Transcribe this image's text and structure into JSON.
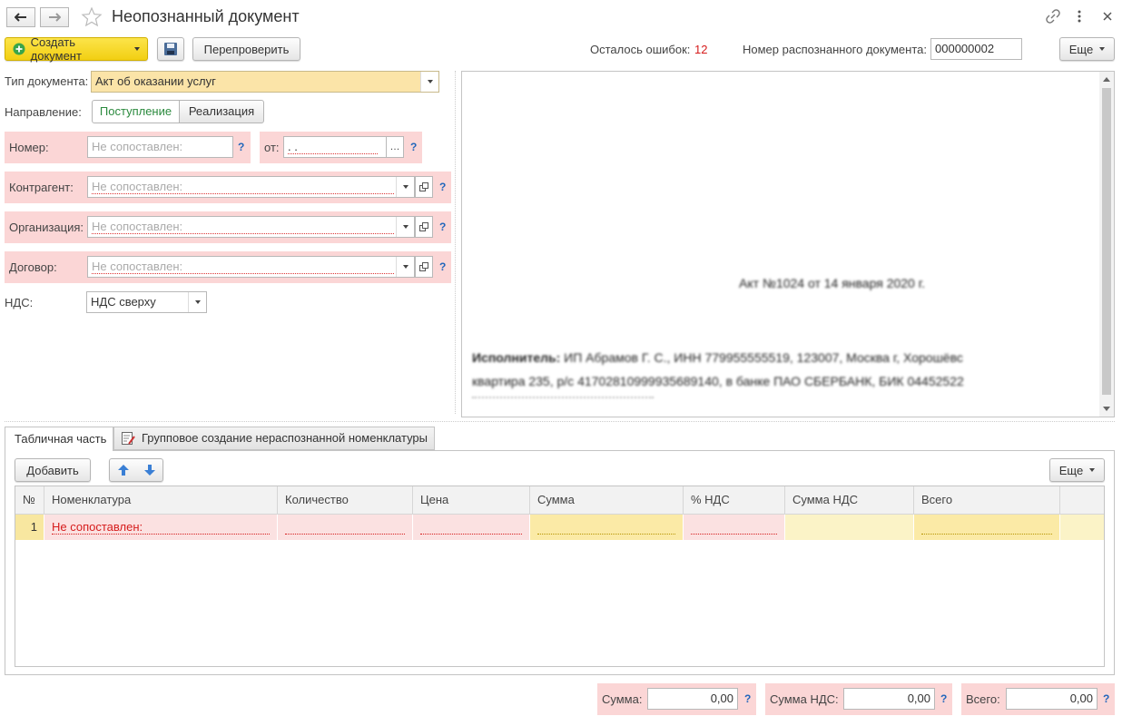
{
  "header": {
    "title": "Неопознанный документ"
  },
  "toolbar": {
    "create_label": "Создать документ",
    "recheck_label": "Перепроверить",
    "errors_label": "Осталось ошибок:",
    "errors_count": "12",
    "recognized_number_label": "Номер распознанного документа:",
    "recognized_number_value": "000000002",
    "more_label": "Еще"
  },
  "form": {
    "doc_type_label": "Тип документа:",
    "doc_type_value": "Акт об оказании услуг",
    "direction_label": "Направление:",
    "direction_options": [
      "Поступление",
      "Реализация"
    ],
    "number_label": "Номер:",
    "number_placeholder": "Не сопоставлен:",
    "date_label": "от:",
    "date_value": ". .",
    "counterparty_label": "Контрагент:",
    "counterparty_placeholder": "Не сопоставлен:",
    "organization_label": "Организация:",
    "organization_placeholder": "Не сопоставлен:",
    "contract_label": "Договор:",
    "contract_placeholder": "Не сопоставлен:",
    "vat_label": "НДС:",
    "vat_value": "НДС сверху",
    "help": "?"
  },
  "preview": {
    "line1": "Акт №1024 от 14 января 2020 г.",
    "line2_bold": "Исполнитель:",
    "line2": "ИП Абрамов Г. С., ИНН 779955555519, 123007, Москва г, Хорошёвс",
    "line3": "квартира 235, р/с 41702810999935689140, в банке ПАО СБЕРБАНК, БИК 04452522"
  },
  "tabs": [
    "Табличная часть",
    "Групповое создание нераспознанной номенклатуры"
  ],
  "table": {
    "add_label": "Добавить",
    "more_label": "Еще",
    "columns": [
      "№",
      "Номенклатура",
      "Количество",
      "Цена",
      "Сумма",
      "% НДС",
      "Сумма НДС",
      "Всего"
    ],
    "rows": [
      {
        "num": "1",
        "item": "Не сопоставлен:"
      }
    ]
  },
  "totals": {
    "sum_label": "Сумма:",
    "sum_value": "0,00",
    "vat_sum_label": "Сумма НДС:",
    "vat_sum_value": "0,00",
    "total_label": "Всего:",
    "total_value": "0,00"
  },
  "colors": {
    "accent_yellow": "#f7d82a",
    "error_red": "#d61c1c",
    "pink": "#fbd6d6",
    "selected_row": "#fbf3c7",
    "green": "#2b8a3e"
  }
}
